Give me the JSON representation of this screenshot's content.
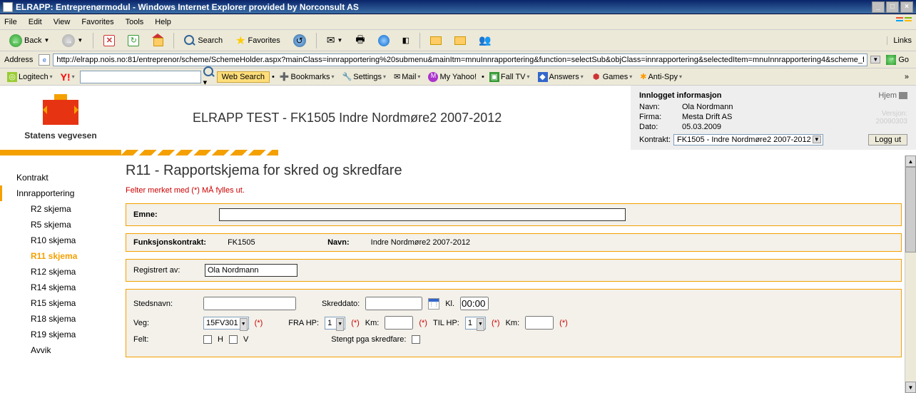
{
  "titlebar": "ELRAPP: Entreprenørmodul - Windows Internet Explorer provided by Norconsult AS",
  "menu": {
    "file": "File",
    "edit": "Edit",
    "view": "View",
    "favorites": "Favorites",
    "tools": "Tools",
    "help": "Help"
  },
  "toolbar": {
    "back": "Back",
    "search": "Search",
    "favorites": "Favorites",
    "links": "Links"
  },
  "addr": {
    "label": "Address",
    "url": "http://elrapp.nois.no:81/entreprenor/scheme/SchemeHolder.aspx?mainClass=innrapportering%20submenu&mainItm=mnuInnrapportering&function=selectSub&objClass=innrapportering&selectedItem=mnuInnrapportering4&scheme_file_nam",
    "go": "Go"
  },
  "sb": {
    "logitech": "Logitech",
    "websearch": "Web Search",
    "bookmarks": "Bookmarks",
    "settings": "Settings",
    "mail": "Mail",
    "myyahoo": "My Yahoo!",
    "falltv": "Fall TV",
    "answers": "Answers",
    "games": "Games",
    "antispy": "Anti-Spy"
  },
  "app": {
    "org": "Statens vegvesen",
    "title": "ELRAPP TEST - FK1505 Indre Nordmøre2 2007-2012",
    "info_head": "Innlogget informasjon",
    "hjem": "Hjem",
    "navn_lbl": "Navn:",
    "navn": "Ola Nordmann",
    "firma_lbl": "Firma:",
    "firma": "Mesta Drift AS",
    "dato_lbl": "Dato:",
    "dato": "05.03.2009",
    "ver_lbl": "Versjon:",
    "ver": "20090303",
    "kontrakt_lbl": "Kontrakt:",
    "kontrakt_val": "FK1505 - Indre Nordmøre2 2007-2012",
    "loggut": "Logg ut"
  },
  "sidebar": {
    "kontrakt": "Kontrakt",
    "innrapportering": "Innrapportering",
    "items": [
      "R2 skjema",
      "R5 skjema",
      "R10 skjema",
      "R11 skjema",
      "R12 skjema",
      "R14 skjema",
      "R15 skjema",
      "R18 skjema",
      "R19 skjema",
      "Avvik"
    ]
  },
  "page": {
    "title": "R11 - Rapportskjema for skred og skredfare",
    "req": "Felter merket med (*) MÅ fylles ut.",
    "emne": "Emne:",
    "fk_lbl": "Funksjonskontrakt:",
    "fk_val": "FK1505",
    "navn_lbl": "Navn:",
    "navn_val": "Indre Nordmøre2 2007-2012",
    "reg_lbl": "Registrert av:",
    "reg_val": "Ola Nordmann",
    "sted": "Stedsnavn:",
    "skreddato": "Skreddato:",
    "kl": "Kl.",
    "kl_val": "00:00",
    "veg": "Veg:",
    "veg_val": "15FV301",
    "frahp": "FRA HP:",
    "frahp_val": "1",
    "km": "Km:",
    "tilhp": "TIL HP:",
    "tilhp_val": "1",
    "km2": "Km:",
    "felt": "Felt:",
    "h": "H",
    "v": "V",
    "stengt": "Stengt pga skredfare:"
  }
}
